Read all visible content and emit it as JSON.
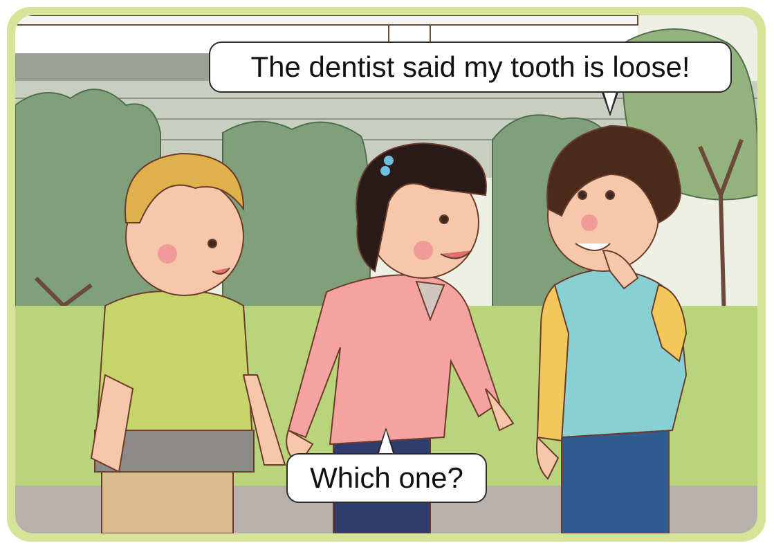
{
  "scene": {
    "speech_bubbles": [
      {
        "id": "dentist",
        "text": "The dentist said my tooth is loose!"
      },
      {
        "id": "which",
        "text": "Which one?"
      }
    ],
    "characters": [
      "blond-boy",
      "girl-pink-sweater",
      "boy-blue-shirt"
    ],
    "colors": {
      "frame": "#d6e49a",
      "grass": "#b9d47a",
      "wall": "#c9cec2",
      "bush": "#7fa07a",
      "pavement": "#b8b0aa"
    }
  }
}
